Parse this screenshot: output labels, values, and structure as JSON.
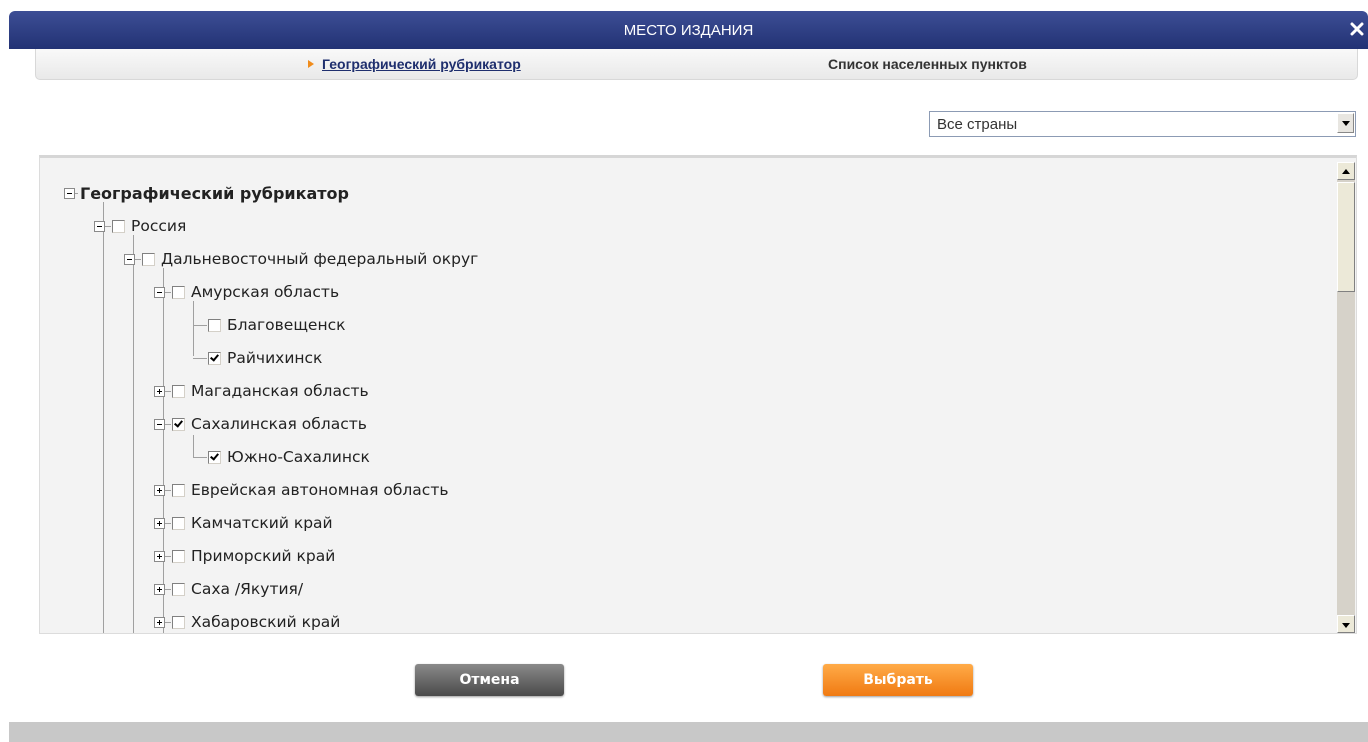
{
  "dialog": {
    "title": "МЕСТО ИЗДАНИЯ",
    "close_icon": "close-x-icon"
  },
  "tabs": [
    {
      "label": "Географический рубрикатор",
      "active": true
    },
    {
      "label": "Список населенных пунктов",
      "active": false
    }
  ],
  "country_select": {
    "selected": "Все страны"
  },
  "tree": {
    "root": {
      "label": "Географический рубрикатор"
    },
    "nodes": [
      {
        "label": "Россия",
        "checked": false,
        "expanded": true
      },
      {
        "label": "Дальневосточный федеральный округ",
        "checked": false,
        "expanded": true
      },
      {
        "label": "Амурская область",
        "checked": false,
        "expanded": true
      },
      {
        "label": "Благовещенск",
        "checked": false,
        "leaf": true
      },
      {
        "label": "Райчихинск",
        "checked": true,
        "leaf": true
      },
      {
        "label": "Магаданская область",
        "checked": false,
        "expanded": false
      },
      {
        "label": "Сахалинская область",
        "checked": true,
        "expanded": true
      },
      {
        "label": "Южно-Сахалинск",
        "checked": true,
        "leaf": true
      },
      {
        "label": "Еврейская автономная область",
        "checked": false,
        "expanded": false
      },
      {
        "label": "Камчатский край",
        "checked": false,
        "expanded": false
      },
      {
        "label": "Приморский край",
        "checked": false,
        "expanded": false
      },
      {
        "label": "Саха /Якутия/",
        "checked": false,
        "expanded": false
      },
      {
        "label": "Хабаровский край",
        "checked": false,
        "expanded": false
      }
    ]
  },
  "buttons": {
    "cancel": "Отмена",
    "select": "Выбрать"
  }
}
